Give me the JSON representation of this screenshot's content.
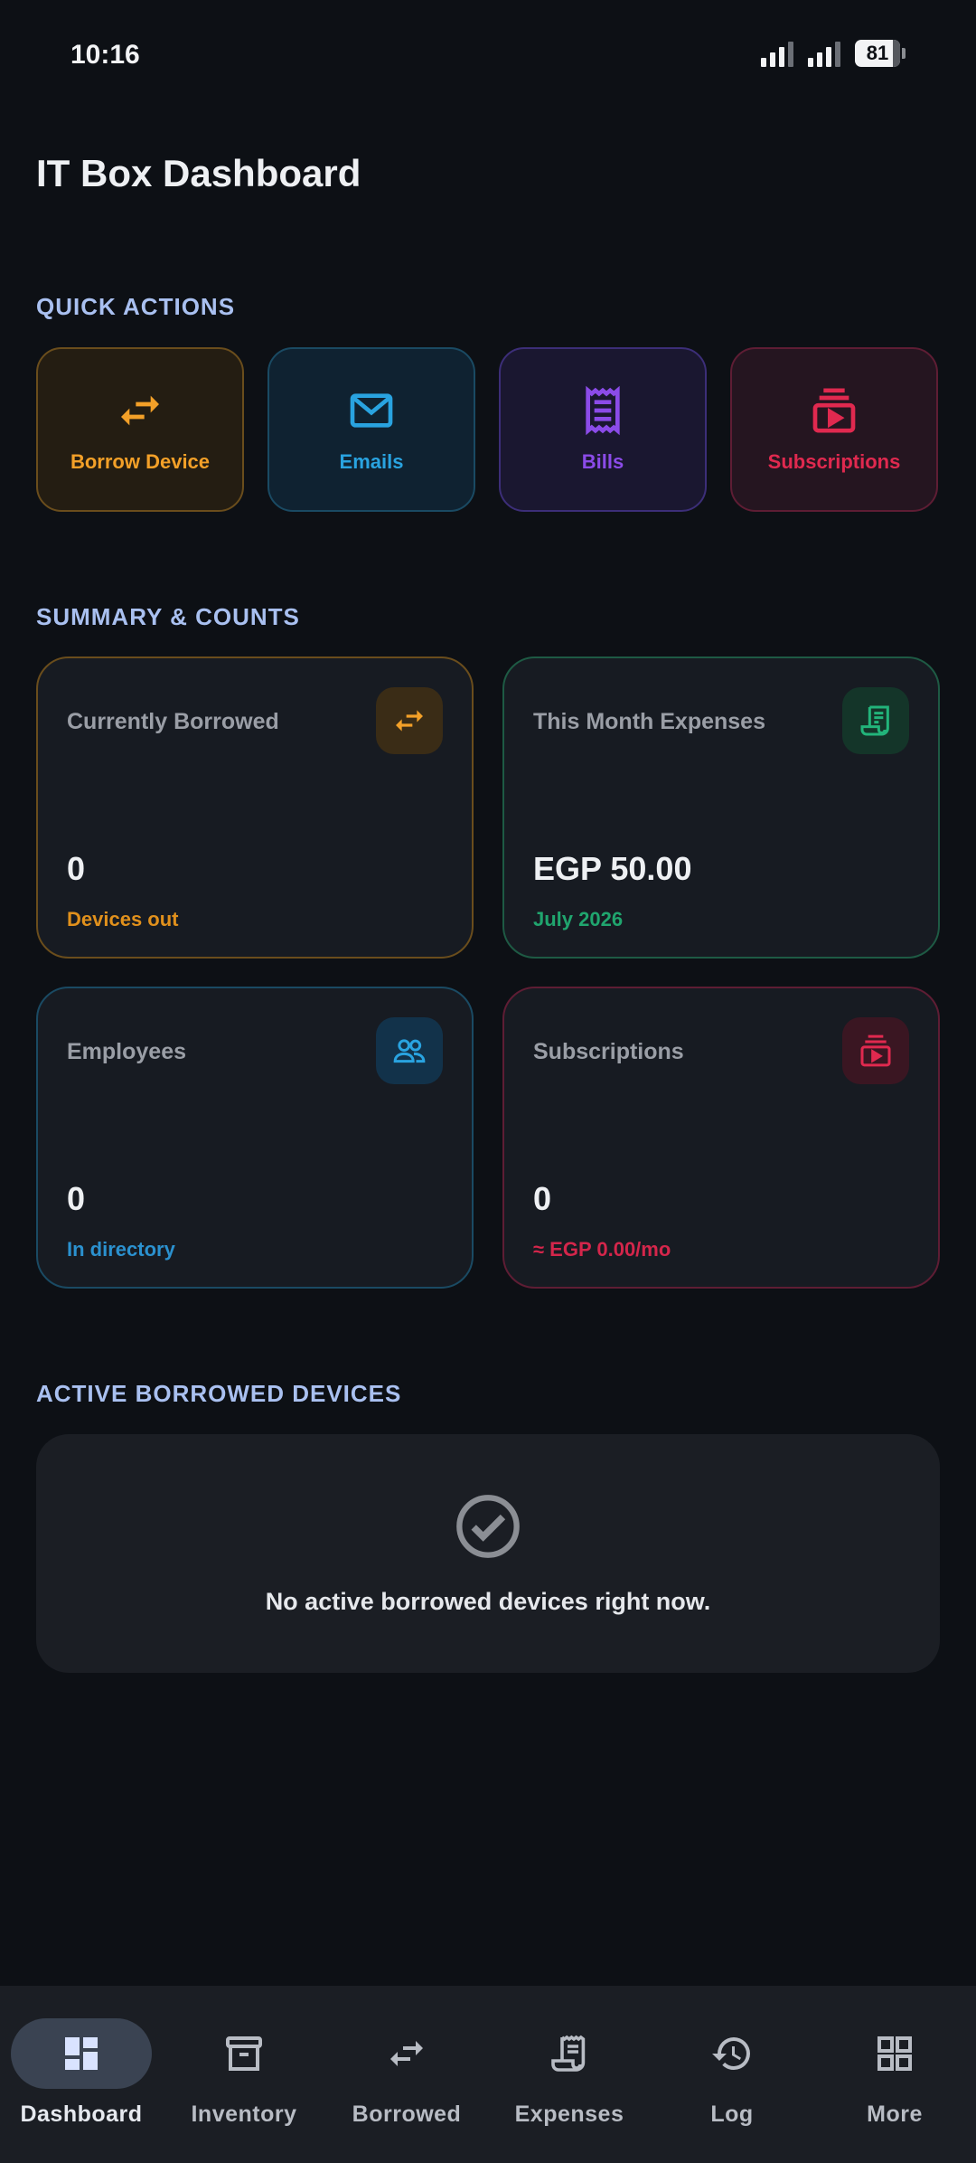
{
  "status_bar": {
    "time": "10:16",
    "battery": "81"
  },
  "page": {
    "title": "IT Box Dashboard"
  },
  "sections": {
    "quick_actions": "QUICK ACTIONS",
    "summary": "SUMMARY & COUNTS",
    "active_borrowed": "ACTIVE BORROWED DEVICES"
  },
  "quick_actions": [
    {
      "label": "Borrow Device",
      "icon": "swap-arrows-icon",
      "color": "#f3a028"
    },
    {
      "label": "Emails",
      "icon": "mail-icon",
      "color": "#29a3e0"
    },
    {
      "label": "Bills",
      "icon": "receipt-icon",
      "color": "#8b4be8"
    },
    {
      "label": "Subscriptions",
      "icon": "subscriptions-icon",
      "color": "#e0294f"
    }
  ],
  "summary_cards": [
    {
      "title": "Currently Borrowed",
      "value": "0",
      "sub": "Devices out",
      "icon": "swap-arrows-icon",
      "color": "#f3a028"
    },
    {
      "title": "This Month Expenses",
      "value": "EGP 50.00",
      "sub": "July 2026",
      "icon": "receipt-long-icon",
      "color": "#22b47a"
    },
    {
      "title": "Employees",
      "value": "0",
      "sub": "In directory",
      "icon": "people-icon",
      "color": "#29a3e0"
    },
    {
      "title": "Subscriptions",
      "value": "0",
      "sub": "≈ EGP 0.00/mo",
      "icon": "subscriptions-icon",
      "color": "#e0294f"
    }
  ],
  "active_borrowed": {
    "empty_message": "No active borrowed devices right now.",
    "icon": "check-circle-icon"
  },
  "bottom_nav": [
    {
      "label": "Dashboard",
      "icon": "dashboard-icon",
      "active": true
    },
    {
      "label": "Inventory",
      "icon": "archive-icon",
      "active": false
    },
    {
      "label": "Borrowed",
      "icon": "swap-arrows-icon",
      "active": false
    },
    {
      "label": "Expenses",
      "icon": "receipt-long-icon",
      "active": false
    },
    {
      "label": "Log",
      "icon": "history-icon",
      "active": false
    },
    {
      "label": "More",
      "icon": "grid-icon",
      "active": false
    }
  ]
}
